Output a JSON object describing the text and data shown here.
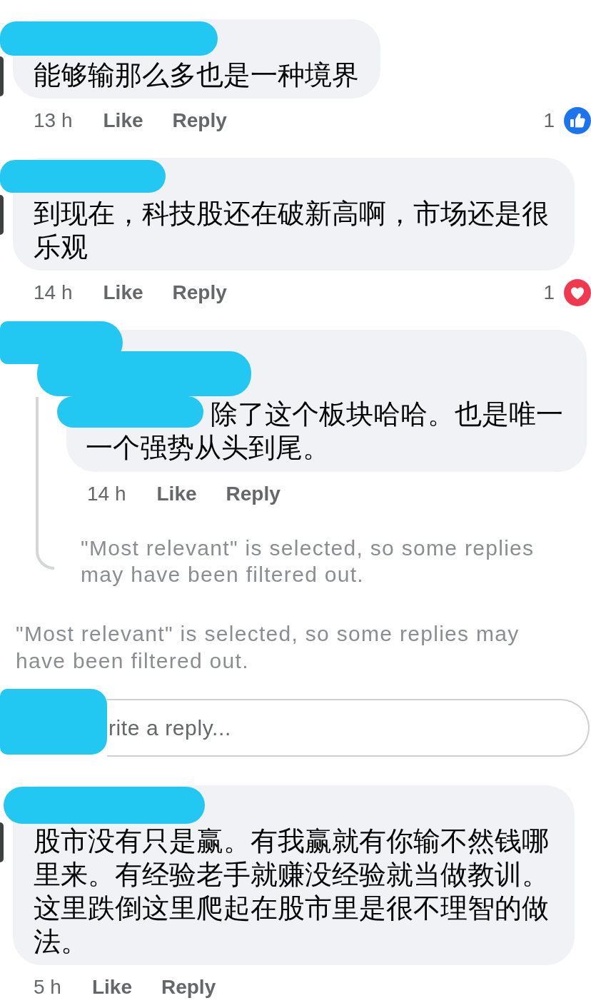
{
  "feed": [
    {
      "kind": "comment",
      "name_hidden": true,
      "text": "能够输那么多也是一种境界",
      "time": "13 h",
      "actions": [
        "Like",
        "Reply"
      ],
      "reaction": {
        "kind": "like",
        "count": "1"
      }
    },
    {
      "kind": "comment",
      "name_hidden": true,
      "text": "到现在，科技股还在破新高啊，市场还是很乐观",
      "time": "14 h",
      "actions": [
        "Like",
        "Reply"
      ],
      "reaction": {
        "kind": "love",
        "count": "1"
      },
      "replies": [
        {
          "name_hidden": true,
          "mention_hidden": true,
          "text": "除了这个板块哈哈。也是唯一一个强势从头到尾。",
          "time": "14 h",
          "actions": [
            "Like",
            "Reply"
          ]
        }
      ],
      "replies_note": "\"Most relevant\" is selected, so some replies may have been filtered out."
    },
    {
      "kind": "note",
      "text": "\"Most relevant\" is selected, so some replies may have been filtered out."
    },
    {
      "kind": "reply_field",
      "avatar_hidden": true,
      "placeholder": "rite a reply..."
    },
    {
      "kind": "comment",
      "name_hidden": true,
      "text": "股市没有只是赢。有我赢就有你输不然钱哪里来。有经验老手就赚没经验就当做教训。这里跌倒这里爬起在股市里是很不理智的做法。",
      "time": "5 h",
      "actions": [
        "Like",
        "Reply"
      ]
    }
  ]
}
